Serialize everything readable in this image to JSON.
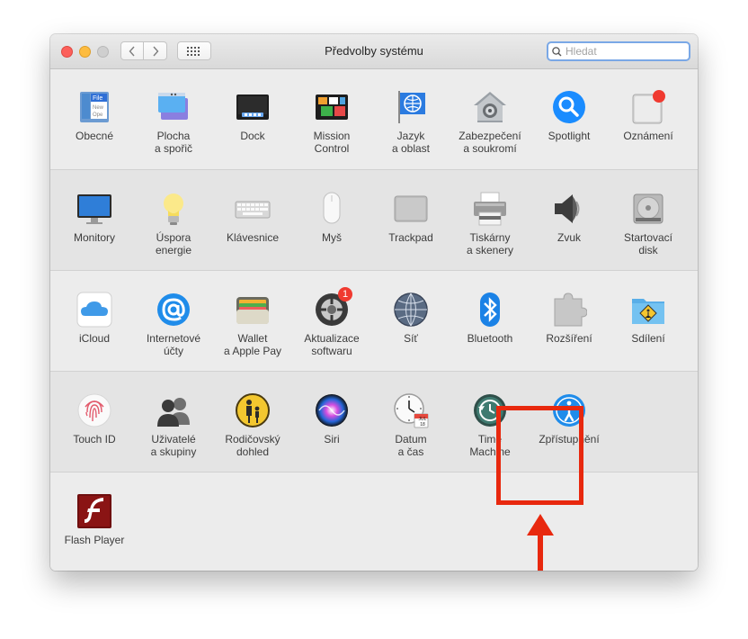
{
  "window": {
    "title": "Předvolby systému"
  },
  "search": {
    "placeholder": "Hledat"
  },
  "rows": [
    [
      {
        "name": "general",
        "label": "Obecné",
        "icon": "general-icon"
      },
      {
        "name": "desktop-screensaver",
        "label": "Plocha\na spořič",
        "icon": "desktop-icon"
      },
      {
        "name": "dock",
        "label": "Dock",
        "icon": "dock-icon"
      },
      {
        "name": "mission-control",
        "label": "Mission\nControl",
        "icon": "mission-control-icon"
      },
      {
        "name": "language-region",
        "label": "Jazyk\na oblast",
        "icon": "globe-flag-icon"
      },
      {
        "name": "security-privacy",
        "label": "Zabezpečení\na soukromí",
        "icon": "house-lock-icon"
      },
      {
        "name": "spotlight",
        "label": "Spotlight",
        "icon": "spotlight-icon"
      },
      {
        "name": "notifications",
        "label": "Oznámení",
        "icon": "notifications-icon"
      }
    ],
    [
      {
        "name": "displays",
        "label": "Monitory",
        "icon": "monitor-icon"
      },
      {
        "name": "energy-saver",
        "label": "Úspora\nenergie",
        "icon": "lightbulb-icon"
      },
      {
        "name": "keyboard",
        "label": "Klávesnice",
        "icon": "keyboard-icon"
      },
      {
        "name": "mouse",
        "label": "Myš",
        "icon": "mouse-icon"
      },
      {
        "name": "trackpad",
        "label": "Trackpad",
        "icon": "trackpad-icon"
      },
      {
        "name": "printers-scanners",
        "label": "Tiskárny\na skenery",
        "icon": "printer-icon"
      },
      {
        "name": "sound",
        "label": "Zvuk",
        "icon": "speaker-icon"
      },
      {
        "name": "startup-disk",
        "label": "Startovací\ndisk",
        "icon": "disk-icon"
      }
    ],
    [
      {
        "name": "icloud",
        "label": "iCloud",
        "icon": "cloud-icon"
      },
      {
        "name": "internet-accounts",
        "label": "Internetové\núčty",
        "icon": "at-sign-icon"
      },
      {
        "name": "wallet-apple-pay",
        "label": "Wallet\na Apple Pay",
        "icon": "wallet-icon"
      },
      {
        "name": "software-update",
        "label": "Aktualizace\nsoftwaru",
        "icon": "gear-icon",
        "badge": "1"
      },
      {
        "name": "network",
        "label": "Síť",
        "icon": "network-globe-icon"
      },
      {
        "name": "bluetooth",
        "label": "Bluetooth",
        "icon": "bluetooth-icon"
      },
      {
        "name": "extensions",
        "label": "Rozšíření",
        "icon": "puzzle-icon"
      },
      {
        "name": "sharing",
        "label": "Sdílení",
        "icon": "sharing-folder-icon"
      }
    ],
    [
      {
        "name": "touch-id",
        "label": "Touch ID",
        "icon": "fingerprint-icon"
      },
      {
        "name": "users-groups",
        "label": "Uživatelé\na skupiny",
        "icon": "users-icon"
      },
      {
        "name": "parental-controls",
        "label": "Rodičovský\ndohled",
        "icon": "parental-icon"
      },
      {
        "name": "siri",
        "label": "Siri",
        "icon": "siri-icon"
      },
      {
        "name": "date-time",
        "label": "Datum\na čas",
        "icon": "clock-calendar-icon",
        "date": "JUL 18"
      },
      {
        "name": "time-machine",
        "label": "Time\nMachine",
        "icon": "time-machine-icon"
      },
      {
        "name": "accessibility",
        "label": "Zpřístupnění",
        "icon": "accessibility-icon"
      }
    ],
    [
      {
        "name": "flash-player",
        "label": "Flash Player",
        "icon": "flash-icon"
      }
    ]
  ],
  "colors": {
    "highlight": "#e8280e",
    "accent": "#1a8cff"
  }
}
